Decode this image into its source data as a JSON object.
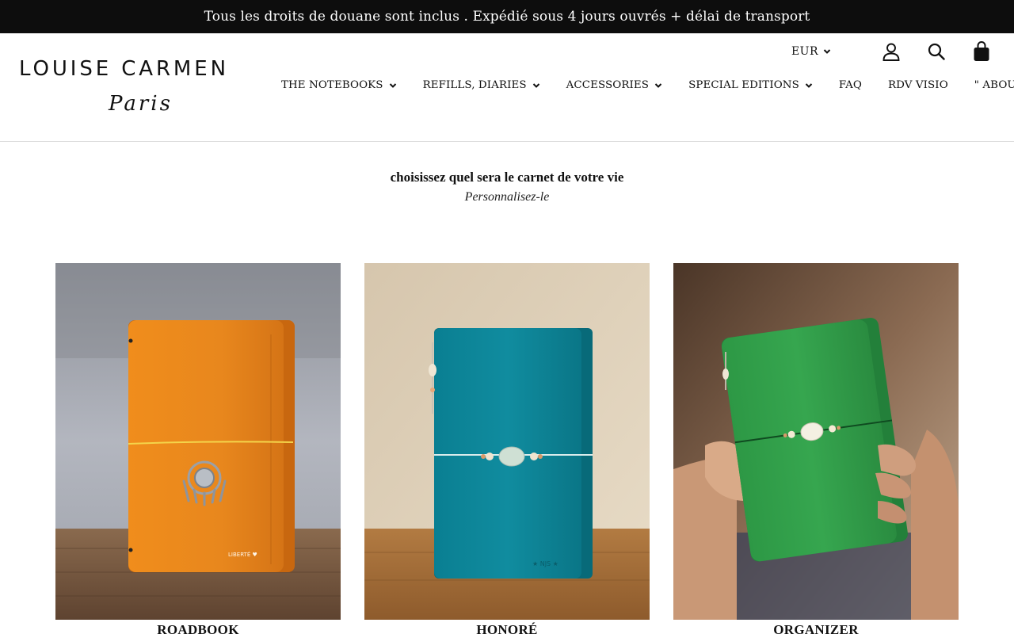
{
  "announcement": "Tous les droits de douane sont inclus . Expédié sous 4 jours ouvrés + délai de transport",
  "logo": {
    "main": "LOUISE CARMEN",
    "sub": "Paris"
  },
  "utility": {
    "currency": "EUR",
    "icons": [
      "user-icon",
      "search-icon",
      "shopping-bag-icon"
    ]
  },
  "nav": [
    {
      "label": "THE NOTEBOOKS",
      "has_dropdown": true
    },
    {
      "label": "REFILLS, DIARIES",
      "has_dropdown": true
    },
    {
      "label": "ACCESSORIES",
      "has_dropdown": true
    },
    {
      "label": "SPECIAL EDITIONS",
      "has_dropdown": true
    },
    {
      "label": "FAQ",
      "has_dropdown": false
    },
    {
      "label": "RDV VISIO",
      "has_dropdown": false
    },
    {
      "label": "\" ABOUT \"",
      "has_dropdown": true
    }
  ],
  "intro": {
    "title": "choisissez quel sera le carnet de votre vie",
    "subtitle": "Personnalisez-le"
  },
  "products": [
    {
      "title": "ROADBOOK",
      "color": "#e88a1e",
      "embossed": "LIBERTÉ ♥"
    },
    {
      "title": "HONORÉ",
      "color": "#0f8a9c",
      "embossed": "★ NJS ★"
    },
    {
      "title": "ORGANIZER",
      "color": "#2f9a45",
      "embossed": ""
    }
  ],
  "colors": {
    "announcement_bg": "#0d0d0d",
    "text": "#111111",
    "border": "#dcdcdc"
  }
}
